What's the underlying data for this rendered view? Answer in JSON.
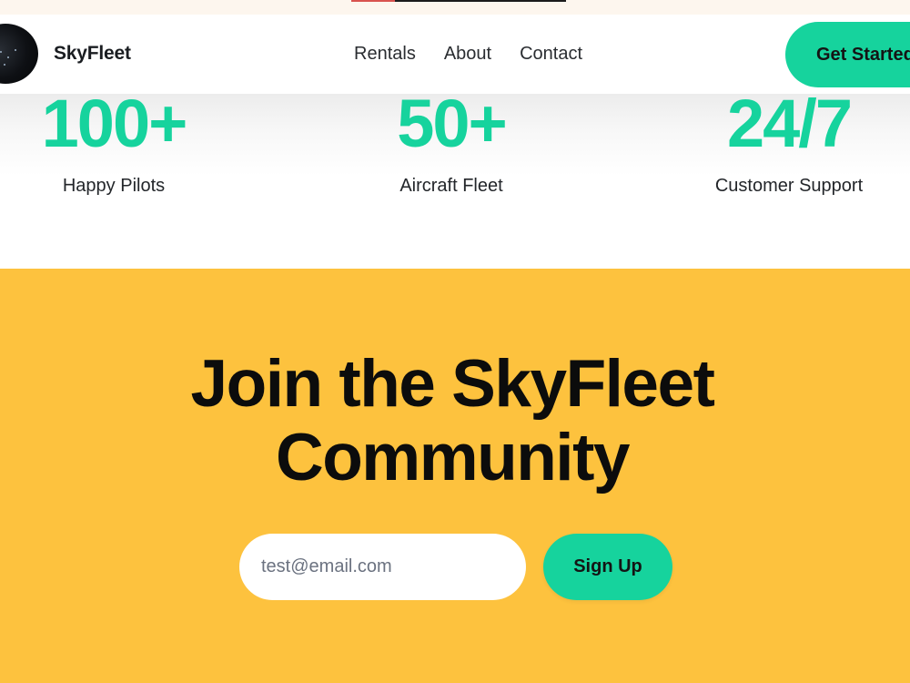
{
  "header": {
    "brand": "SkyFleet",
    "nav": [
      "Rentals",
      "About",
      "Contact"
    ],
    "cta_label": "Get Started"
  },
  "stats": [
    {
      "value": "100+",
      "label": "Happy Pilots"
    },
    {
      "value": "50+",
      "label": "Aircraft Fleet"
    },
    {
      "value": "24/7",
      "label": "Customer Support"
    }
  ],
  "community": {
    "title_line1": "Join the SkyFleet",
    "title_line2": "Community",
    "email_value": "",
    "email_placeholder": "test@email.com",
    "signup_label": "Sign Up"
  },
  "colors": {
    "accent": "#16d39d",
    "banner_background": "#fdc23e",
    "heading": "#0c0c0c"
  },
  "icons": {
    "logo": "aircraft-night-photo-logo"
  }
}
